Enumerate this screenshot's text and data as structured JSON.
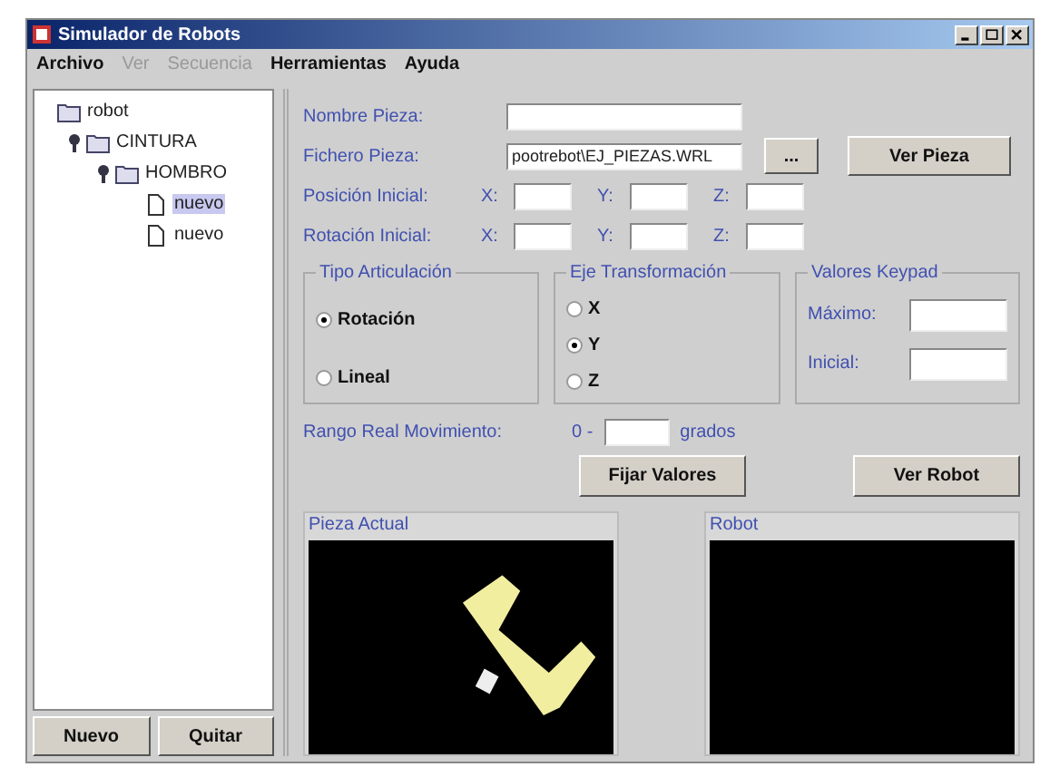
{
  "window": {
    "title": "Simulador de Robots"
  },
  "menu": [
    {
      "label": "Archivo",
      "disabled": false
    },
    {
      "label": "Ver",
      "disabled": true
    },
    {
      "label": "Secuencia",
      "disabled": true
    },
    {
      "label": "Herramientas",
      "disabled": false
    },
    {
      "label": "Ayuda",
      "disabled": false
    }
  ],
  "tree": [
    {
      "label": "robot",
      "kind": "folder",
      "selected": false,
      "children": [
        {
          "label": "CINTURA",
          "kind": "folder",
          "expanded": true,
          "selected": false,
          "children": [
            {
              "label": "HOMBRO",
              "kind": "folder",
              "expanded": true,
              "selected": false,
              "children": [
                {
                  "label": "nuevo",
                  "kind": "file",
                  "selected": true
                },
                {
                  "label": "nuevo",
                  "kind": "file",
                  "selected": false
                }
              ]
            }
          ]
        }
      ]
    }
  ],
  "tree_buttons": [
    "Nuevo",
    "Quitar"
  ],
  "nombre_pieza": {
    "label": "Nombre Pieza:"
  },
  "fichero_pieza": {
    "label": "Fichero Pieza:",
    "value": "pootrebot\\EJ_PIEZAS.WRL",
    "browse": "...",
    "view": "Ver Pieza"
  },
  "coords": [
    {
      "label": "Posición Inicial:",
      "axes": [
        "X:",
        "Y:",
        "Z:"
      ]
    },
    {
      "label": "Rotación Inicial:",
      "axes": [
        "X:",
        "Y:",
        "Z:"
      ]
    }
  ],
  "tipo_articulacion": {
    "title": "Tipo Articulación",
    "options": [
      {
        "label": "Rotación",
        "selected": true
      },
      {
        "label": "Lineal",
        "selected": false
      }
    ]
  },
  "eje_transformacion": {
    "title": "Eje Transformación",
    "options": [
      {
        "label": "X",
        "selected": false
      },
      {
        "label": "Y",
        "selected": true
      },
      {
        "label": "Z",
        "selected": false
      }
    ]
  },
  "valores_keypad": {
    "title": "Valores Keypad",
    "fields": [
      "Máximo:",
      "Inicial:"
    ]
  },
  "rango": {
    "label": "Rango Real Movimiento:",
    "prefix": "0 -",
    "suffix": "grados"
  },
  "buttons": [
    "Fijar Valores",
    "Ver Robot"
  ],
  "viewports": [
    {
      "title": "Pieza Actual",
      "kind": "piece"
    },
    {
      "title": "Robot",
      "kind": "empty"
    }
  ]
}
